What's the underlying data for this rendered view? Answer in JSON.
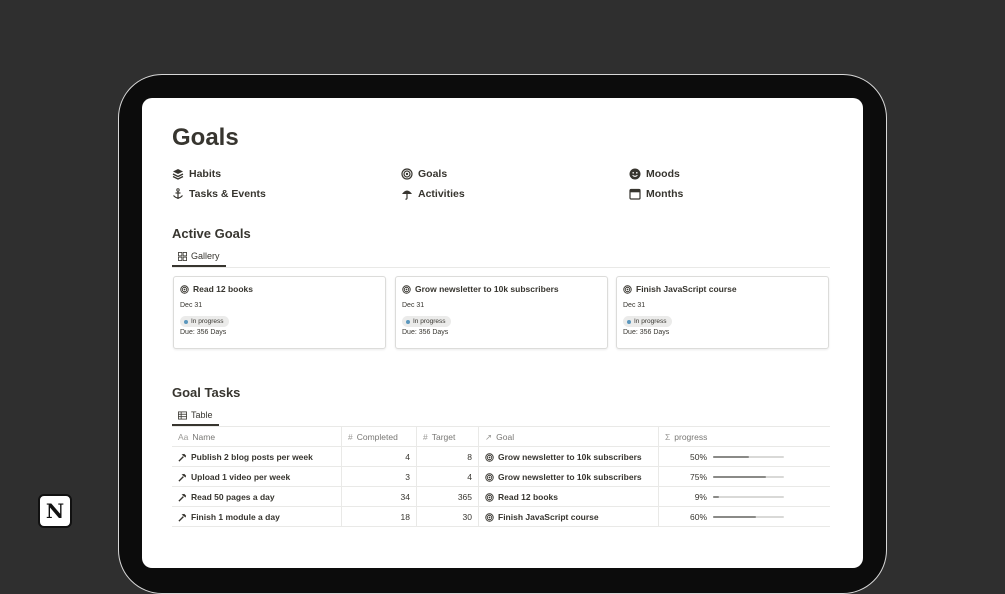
{
  "page": {
    "title": "Goals"
  },
  "nav": [
    {
      "label": "Habits",
      "icon": "layers-icon"
    },
    {
      "label": "Tasks & Events",
      "icon": "anchor-icon"
    },
    {
      "label": "Goals",
      "icon": "target-icon"
    },
    {
      "label": "Activities",
      "icon": "umbrella-icon"
    },
    {
      "label": "Moods",
      "icon": "smiley-icon"
    },
    {
      "label": "Months",
      "icon": "calendar-icon"
    }
  ],
  "active_goals": {
    "title": "Active Goals",
    "view_tab": "Gallery",
    "cards": [
      {
        "title": "Read 12 books",
        "date": "Dec 31",
        "status": "In progress",
        "due": "Due: 356 Days"
      },
      {
        "title": "Grow newsletter to 10k subscribers",
        "date": "Dec 31",
        "status": "In progress",
        "due": "Due: 356 Days"
      },
      {
        "title": "Finish JavaScript course",
        "date": "Dec 31",
        "status": "In progress",
        "due": "Due: 356 Days"
      }
    ]
  },
  "goal_tasks": {
    "title": "Goal Tasks",
    "view_tab": "Table",
    "columns": {
      "name": {
        "icon_text": "Aa",
        "label": "Name"
      },
      "completed": {
        "icon_text": "#",
        "label": "Completed"
      },
      "target": {
        "icon_text": "#",
        "label": "Target"
      },
      "goal": {
        "icon_text": "↗",
        "label": "Goal"
      },
      "progress": {
        "icon_text": "Σ",
        "label": "progress"
      }
    },
    "rows": [
      {
        "name": "Publish 2 blog posts per week",
        "completed": "4",
        "target": "8",
        "goal": "Grow newsletter to 10k subscribers",
        "progress_label": "50%",
        "progress": 0.5
      },
      {
        "name": "Upload 1 video per week",
        "completed": "3",
        "target": "4",
        "goal": "Grow newsletter to 10k subscribers",
        "progress_label": "75%",
        "progress": 0.75
      },
      {
        "name": "Read 50 pages a day",
        "completed": "34",
        "target": "365",
        "goal": "Read 12 books",
        "progress_label": "9%",
        "progress": 0.09
      },
      {
        "name": "Finish 1 module a day",
        "completed": "18",
        "target": "30",
        "goal": "Finish JavaScript course",
        "progress_label": "60%",
        "progress": 0.6
      }
    ]
  },
  "logo": {
    "letter": "N"
  },
  "colors": {
    "background": "#2f2f2f",
    "text": "#37352f",
    "status_dot": "#5b97bd"
  }
}
